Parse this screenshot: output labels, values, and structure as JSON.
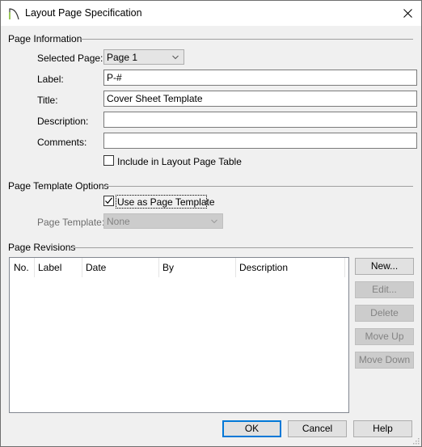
{
  "window": {
    "title": "Layout Page Specification",
    "icon": "app-arc-icon",
    "close_icon": "close-icon"
  },
  "page_information": {
    "group_label": "Page Information",
    "selected_page": {
      "label": "Selected Page:",
      "value": "Page 1"
    },
    "label_field": {
      "label": "Label:",
      "value": "P-#"
    },
    "title_field": {
      "label": "Title:",
      "value": "Cover Sheet Template"
    },
    "description_field": {
      "label": "Description:",
      "value": ""
    },
    "comments_field": {
      "label": "Comments:",
      "value": ""
    },
    "include_checkbox": {
      "label": "Include in Layout Page Table",
      "checked": false
    }
  },
  "page_template_options": {
    "group_label": "Page Template Options",
    "use_as_template": {
      "label": "Use as Page Template",
      "checked": true
    },
    "page_template": {
      "label": "Page Template:",
      "value": "None",
      "enabled": false
    }
  },
  "page_revisions": {
    "group_label": "Page Revisions",
    "columns": [
      "No.",
      "Label",
      "Date",
      "By",
      "Description"
    ],
    "rows": [],
    "buttons": [
      {
        "label": "New...",
        "enabled": true
      },
      {
        "label": "Edit...",
        "enabled": false
      },
      {
        "label": "Delete",
        "enabled": false
      },
      {
        "label": "Move Up",
        "enabled": false
      },
      {
        "label": "Move Down",
        "enabled": false
      }
    ]
  },
  "footer": {
    "ok_label": "OK",
    "cancel_label": "Cancel",
    "help_label": "Help"
  },
  "colors": {
    "focus_accent": "#0078d7",
    "app_icon_accent": "#8dc63f"
  }
}
